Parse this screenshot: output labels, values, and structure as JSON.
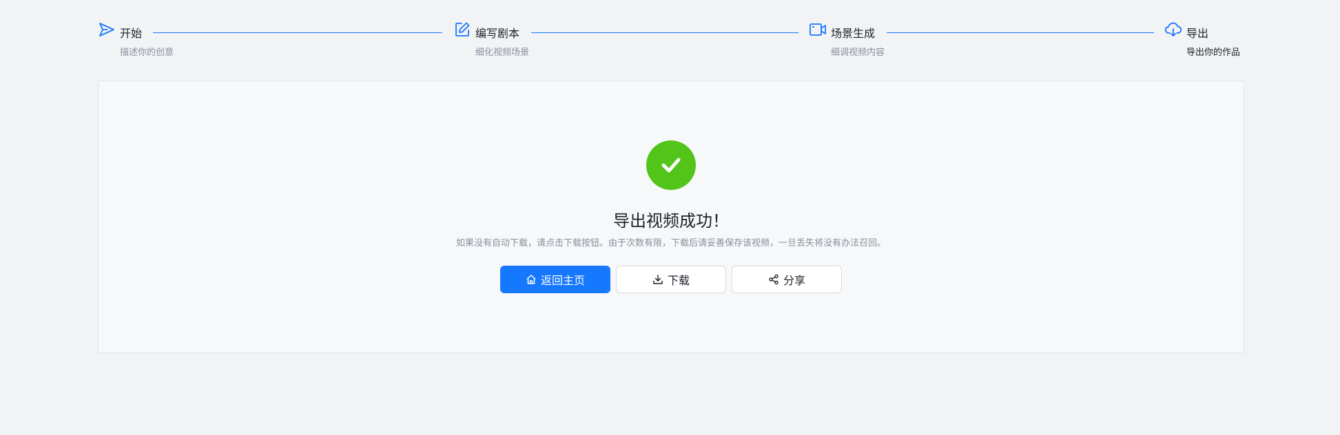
{
  "steps": [
    {
      "icon": "send-icon",
      "title": "开始",
      "description": "描述你的创意",
      "active": false
    },
    {
      "icon": "edit-icon",
      "title": "编写剧本",
      "description": "细化视频场景",
      "active": false
    },
    {
      "icon": "video-camera-icon",
      "title": "场景生成",
      "description": "细调视频内容",
      "active": false
    },
    {
      "icon": "cloud-download-icon",
      "title": "导出",
      "description": "导出你的作品",
      "active": true
    }
  ],
  "result": {
    "status_icon": "check-circle-icon",
    "title": "导出视频成功！",
    "subtitle": "如果没有自动下载，请点击下载按钮。由于次数有限，下载后请妥善保存该视频，一旦丢失将没有办法召回。"
  },
  "actions": {
    "home": {
      "label": "返回主页",
      "icon": "home-icon"
    },
    "download": {
      "label": "下载",
      "icon": "download-icon"
    },
    "share": {
      "label": "分享",
      "icon": "share-icon"
    }
  },
  "colors": {
    "accent": "#1677ff",
    "success": "#52c41a",
    "background": "#f2f3f5",
    "panel": "#f7f8fa",
    "muted_text": "#86909c"
  }
}
